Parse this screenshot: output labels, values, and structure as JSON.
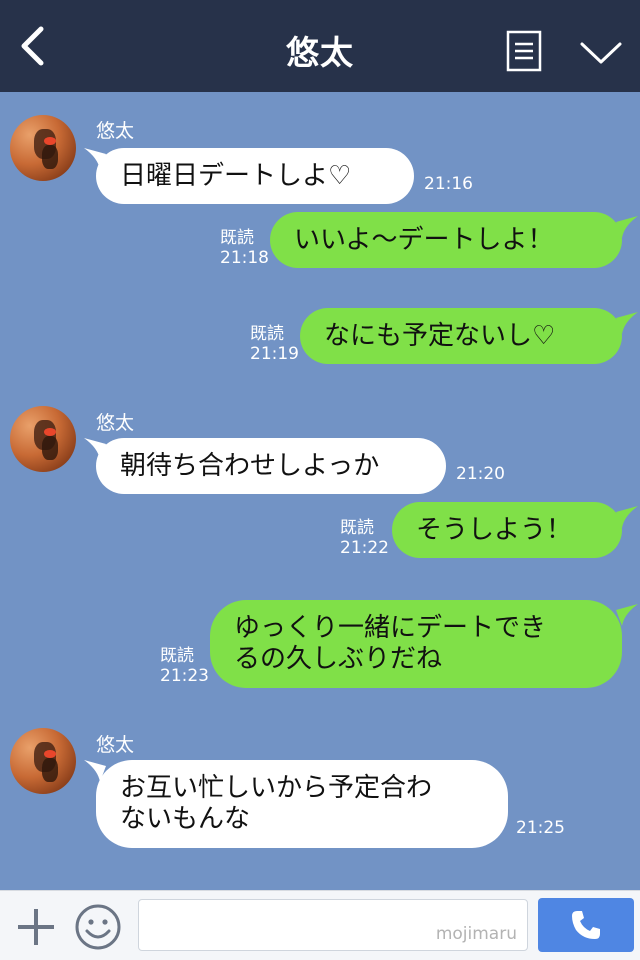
{
  "header": {
    "title": "悠太",
    "back_icon": "back-chevron-icon",
    "menu_icon": "menu-list-icon",
    "dropdown_icon": "chevron-down-icon"
  },
  "messages": [
    {
      "sender": "悠太",
      "text": "日曜日デートしよ♡",
      "time": "21:16",
      "side": "left"
    },
    {
      "read": "既読",
      "time": "21:18",
      "text": "いいよ〜デートしよ！",
      "side": "right"
    },
    {
      "read": "既読",
      "time": "21:19",
      "text": "なにも予定ないし♡",
      "side": "right"
    },
    {
      "sender": "悠太",
      "text": "朝待ち合わせしよっか",
      "time": "21:20",
      "side": "left"
    },
    {
      "read": "既読",
      "time": "21:22",
      "text": "そうしよう！",
      "side": "right"
    },
    {
      "read": "既読",
      "time": "21:23",
      "line1": "ゆっくり一緒にデートでき",
      "line2": "るの久しぶりだね",
      "side": "right"
    },
    {
      "sender": "悠太",
      "line1": "お互い忙しいから予定合わ",
      "line2": "ないもんな",
      "time": "21:25",
      "side": "left"
    }
  ],
  "footer": {
    "input_value": "",
    "watermark": "mojimaru",
    "plus_icon": "plus-icon",
    "emoji_icon": "smiley-icon",
    "call_icon": "phone-icon"
  },
  "colors": {
    "header_bg": "#27324a",
    "chat_bg": "#7293c5",
    "bubble_sent": "#80e048",
    "bubble_received": "#ffffff",
    "call_button": "#4f86e3"
  }
}
